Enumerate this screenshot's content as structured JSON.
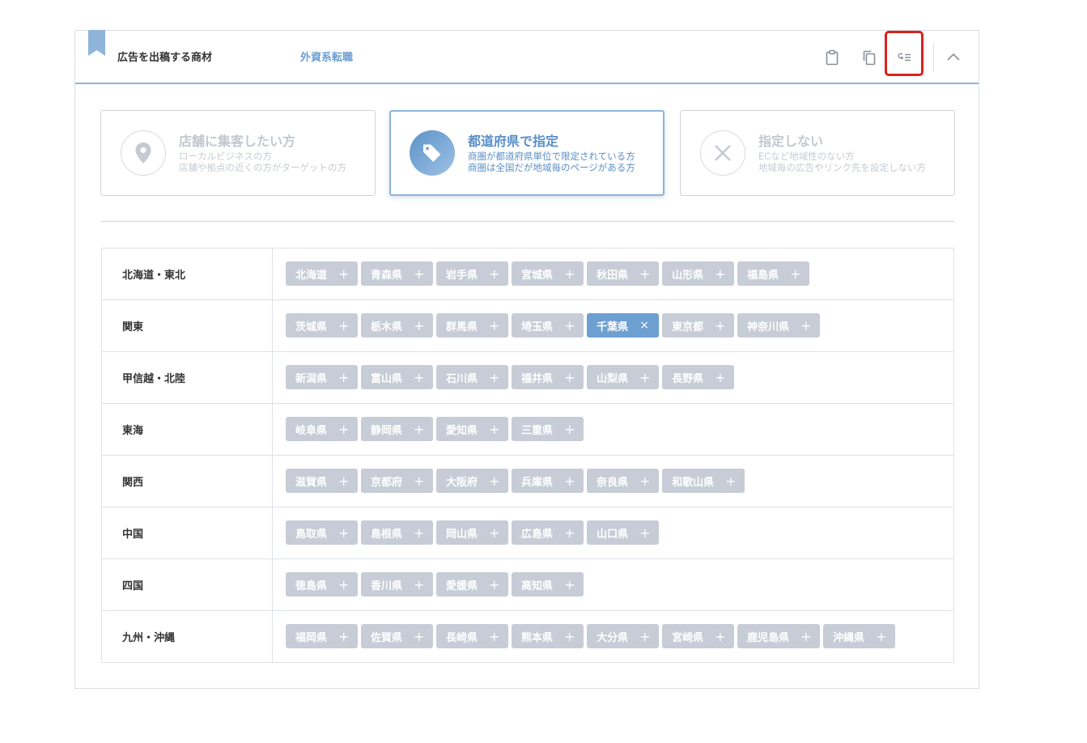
{
  "header": {
    "title": "広告を出稿する商材",
    "value": "外資系転職",
    "bookmark_color": "#8fb4da",
    "highlight_color": "#d9221c",
    "icons": [
      "clipboard-icon",
      "copy-icon",
      "list-format-icon",
      "chevron-up-icon"
    ]
  },
  "options": [
    {
      "title": "店舗に集客したい方",
      "desc1": "ローカルビジネスの方",
      "desc2": "店舗や拠点の近くの方がターゲットの方",
      "icon": "location-pin-icon",
      "selected": false
    },
    {
      "title": "都道府県で指定",
      "desc1": "商圏が都道府県単位で限定されている方",
      "desc2": "商圏は全国だが地域毎のページがある方",
      "icon": "tag-icon",
      "selected": true
    },
    {
      "title": "指定しない",
      "desc1": "ECなど地域性のない方",
      "desc2": "地域毎の広告やリンク先を設定しない方",
      "icon": "x-mark-icon",
      "selected": false
    }
  ],
  "regions": [
    {
      "name": "北海道・東北",
      "prefectures": [
        "北海道",
        "青森県",
        "岩手県",
        "宮城県",
        "秋田県",
        "山形県",
        "福島県"
      ]
    },
    {
      "name": "関東",
      "prefectures": [
        "茨城県",
        "栃木県",
        "群馬県",
        "埼玉県",
        "千葉県",
        "東京都",
        "神奈川県"
      ]
    },
    {
      "name": "甲信越・北陸",
      "prefectures": [
        "新潟県",
        "富山県",
        "石川県",
        "福井県",
        "山梨県",
        "長野県"
      ]
    },
    {
      "name": "東海",
      "prefectures": [
        "岐阜県",
        "静岡県",
        "愛知県",
        "三重県"
      ]
    },
    {
      "name": "関西",
      "prefectures": [
        "滋賀県",
        "京都府",
        "大阪府",
        "兵庫県",
        "奈良県",
        "和歌山県"
      ]
    },
    {
      "name": "中国",
      "prefectures": [
        "鳥取県",
        "島根県",
        "岡山県",
        "広島県",
        "山口県"
      ]
    },
    {
      "name": "四国",
      "prefectures": [
        "徳島県",
        "香川県",
        "愛媛県",
        "高知県"
      ]
    },
    {
      "name": "九州・沖縄",
      "prefectures": [
        "福岡県",
        "佐賀県",
        "長崎県",
        "熊本県",
        "大分県",
        "宮崎県",
        "鹿児島県",
        "沖縄県"
      ]
    }
  ],
  "selected_prefectures": [
    "千葉県"
  ],
  "chip_add_symbol": "+",
  "chip_remove_symbol": "×",
  "colors": {
    "accent": "#6d9fd1",
    "chip_default": "#c7ccd6",
    "chip_selected": "#6d9fd1"
  }
}
